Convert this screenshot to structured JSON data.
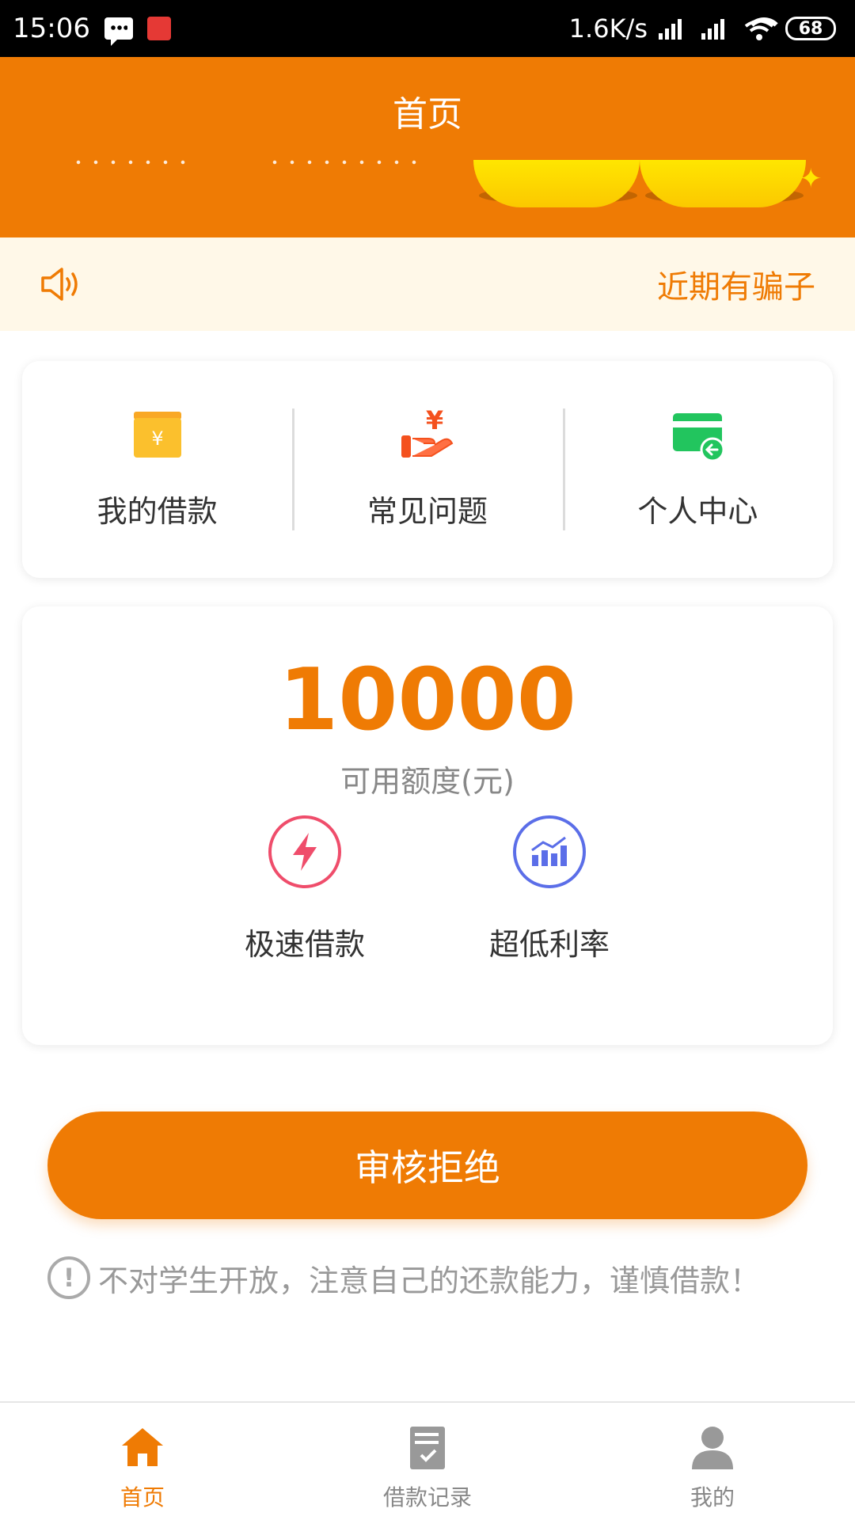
{
  "status_bar": {
    "time": "15:06",
    "net_speed": "1.6K/s",
    "battery": "68"
  },
  "header": {
    "title": "首页"
  },
  "notice": {
    "text": "近期有骗子",
    "icon": "speaker-icon"
  },
  "menu": {
    "items": [
      {
        "label": "我的借款",
        "icon": "wallet-yen-icon",
        "color": "#fbc02d"
      },
      {
        "label": "常见问题",
        "icon": "hand-yen-icon",
        "color": "#f4511e"
      },
      {
        "label": "个人中心",
        "icon": "card-return-icon",
        "color": "#22c55e"
      }
    ]
  },
  "credit": {
    "amount": "10000",
    "label": "可用额度(元)",
    "features": [
      {
        "label": "极速借款",
        "icon": "lightning-icon",
        "color": "#ef4d6b"
      },
      {
        "label": "超低利率",
        "icon": "chart-up-icon",
        "color": "#5b6ee8"
      }
    ]
  },
  "action_button": {
    "label": "审核拒绝"
  },
  "warning": {
    "text": "不对学生开放，注意自己的还款能力，谨慎借款！"
  },
  "tabbar": {
    "items": [
      {
        "label": "首页",
        "icon": "home-icon",
        "active": true
      },
      {
        "label": "借款记录",
        "icon": "document-check-icon",
        "active": false
      },
      {
        "label": "我的",
        "icon": "person-icon",
        "active": false
      }
    ]
  },
  "colors": {
    "accent": "#ef7b04",
    "notice_bg": "#fff8e8"
  }
}
